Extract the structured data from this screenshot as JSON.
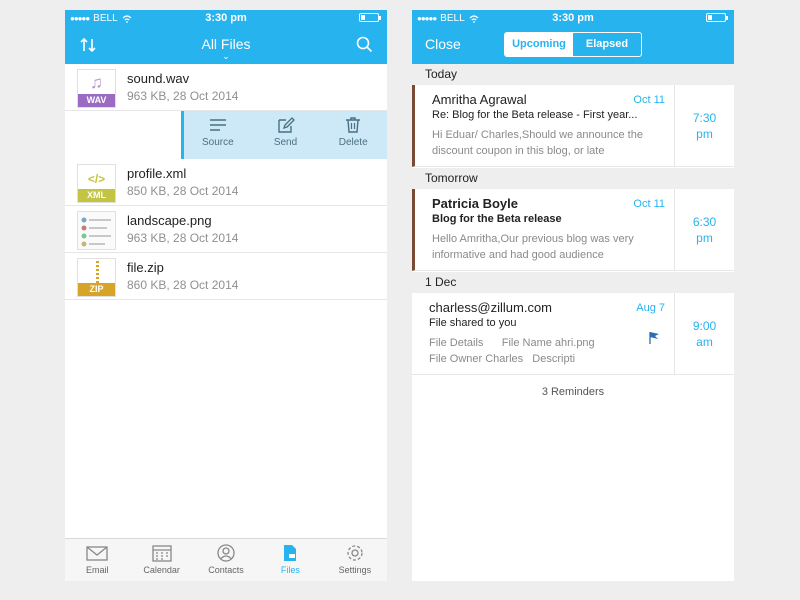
{
  "status": {
    "carrier": "BELL",
    "time": "3:30 pm"
  },
  "files_screen": {
    "title": "All Files",
    "files": [
      {
        "name": "sound.wav",
        "meta": "963 KB, 28 Oct 2014",
        "type": "WAV",
        "color": "#9b6bc4"
      },
      {
        "name": "profile.xml",
        "meta": "850 KB, 28 Oct 2014",
        "type": "XML",
        "color": "#c2c442"
      },
      {
        "name": "landscape.png",
        "meta": "963 KB, 28 Oct 2014",
        "type": ""
      },
      {
        "name": "file.zip",
        "meta": "860 KB, 28 Oct 2014",
        "type": "ZIP",
        "color": "#d6a527"
      }
    ],
    "actions": [
      "Source",
      "Send",
      "Delete"
    ],
    "tabs": [
      "Email",
      "Calendar",
      "Contacts",
      "Files",
      "Settings"
    ],
    "active_tab": "Files"
  },
  "reminders_screen": {
    "close_label": "Close",
    "segments": [
      "Upcoming",
      "Elapsed"
    ],
    "active_segment": "Upcoming",
    "sections": [
      {
        "label": "Today",
        "items": [
          {
            "from": "Amritha Agrawal",
            "date": "Oct 11",
            "subject": "Re: Blog for the Beta release - First year...",
            "preview": "Hi Eduar/ Charles,Should we announce the discount coupon in this blog, or late",
            "time": "7:30",
            "ampm": "pm"
          }
        ]
      },
      {
        "label": "Tomorrow",
        "items": [
          {
            "from": "Patricia Boyle",
            "date": "Oct 11",
            "subject": "Blog for the Beta release",
            "preview": "Hello Amritha,Our previous blog was very informative and had good audience",
            "time": "6:30",
            "ampm": "pm"
          }
        ]
      },
      {
        "label": "1 Dec",
        "items": [
          {
            "from": "charless@zillum.com",
            "date": "Aug 7",
            "subject": "File shared to you",
            "preview_line1": "File Details      File Name ahri.png",
            "preview_line2": "File Owner Charles   Descripti",
            "time": "9:00",
            "ampm": "am"
          }
        ]
      }
    ],
    "reminder_count": "3 Reminders"
  },
  "colors": {
    "accent": "#27b3ed",
    "flag_bar": "#7a4a35"
  }
}
